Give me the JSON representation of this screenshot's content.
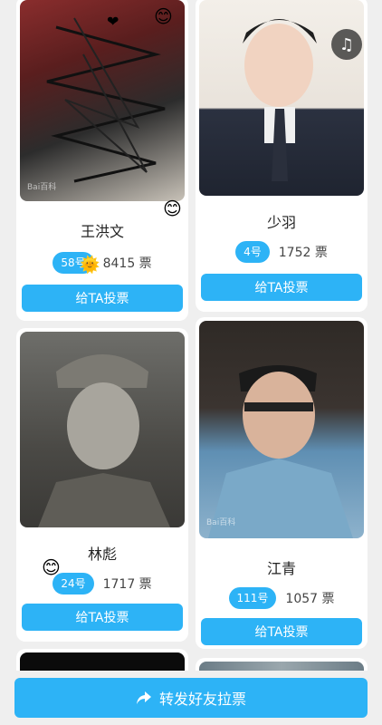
{
  "cards": [
    {
      "name": "王洪文",
      "number": "58号",
      "votes": "8415 票",
      "button": "给TA投票"
    },
    {
      "name": "少羽",
      "number": "4号",
      "votes": "1752 票",
      "button": "给TA投票"
    },
    {
      "name": "林彪",
      "number": "24号",
      "votes": "1717 票",
      "button": "给TA投票"
    },
    {
      "name": "江青",
      "number": "111号",
      "votes": "1057 票",
      "button": "给TA投票"
    }
  ],
  "bottom": {
    "share_label": "转发好友拉票"
  },
  "icons": {
    "share": "share-arrow-icon",
    "music": "music-note-icon",
    "emoji_hearts": "hearts-emoji-icon",
    "emoji_smile": "smile-emoji-icon",
    "emoji_sun": "sun-emoji-icon"
  },
  "watermark": "Bai百科",
  "colors": {
    "accent": "#2db3f6",
    "background": "#efefef"
  }
}
